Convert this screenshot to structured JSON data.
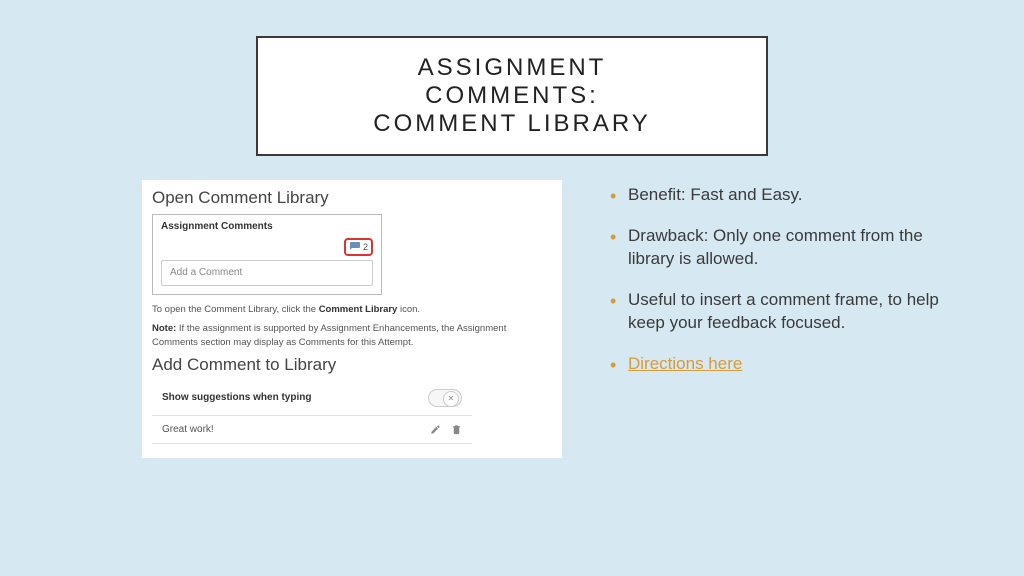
{
  "title": {
    "line1": "ASSIGNMENT COMMENTS:",
    "line2": "COMMENT LIBRARY"
  },
  "panel": {
    "open_heading": "Open Comment Library",
    "comments_label": "Assignment Comments",
    "icon_count": "2",
    "add_placeholder": "Add a Comment",
    "instruction_prefix": "To open the Comment Library, click the ",
    "instruction_bold": "Comment Library",
    "instruction_suffix": " icon.",
    "note_label": "Note:",
    "note_text": " If the assignment is supported by Assignment Enhancements, the Assignment Comments section may display as Comments for this Attempt.",
    "add_heading": "Add Comment to Library",
    "suggestions_label": "Show suggestions when typing",
    "entry_text": "Great work!"
  },
  "bullets": [
    "Benefit: Fast and Easy.",
    "Drawback: Only one comment from the library is allowed.",
    "Useful to insert a comment frame, to help keep your feedback focused."
  ],
  "link_text": "Directions here"
}
